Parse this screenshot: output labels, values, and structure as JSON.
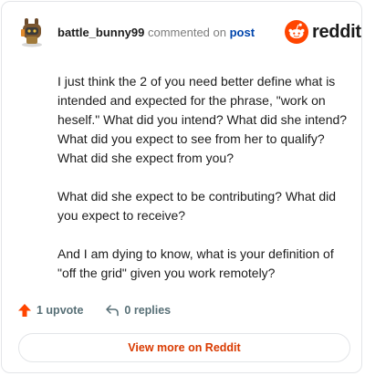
{
  "comment": {
    "username": "battle_bunny99",
    "action_text": "commented on",
    "post_link": "post",
    "paragraphs": [
      "I just think the 2 of you need better define what is intended and expected for the phrase, \"work on heself.\" What did you intend? What did she intend? What did you expect to see from her to qualify? What did she expect from you?",
      "What did she expect to be contributing? What did you expect to receive?",
      "And I am dying to know, what is your definition of \"off the grid\" given you work remotely?"
    ]
  },
  "brand": {
    "wordmark": "reddit",
    "color": "#ff4500",
    "icon": "reddit-snoo-icon"
  },
  "actions": {
    "upvote_label": "1 upvote",
    "upvote_icon": "upvote-arrow-icon",
    "replies_label": "0 replies",
    "replies_icon": "reply-arrow-icon"
  },
  "footer": {
    "view_more_label": "View more on Reddit"
  },
  "colors": {
    "accent": "#d93a00",
    "link": "#0045ac",
    "muted": "#576f76"
  }
}
